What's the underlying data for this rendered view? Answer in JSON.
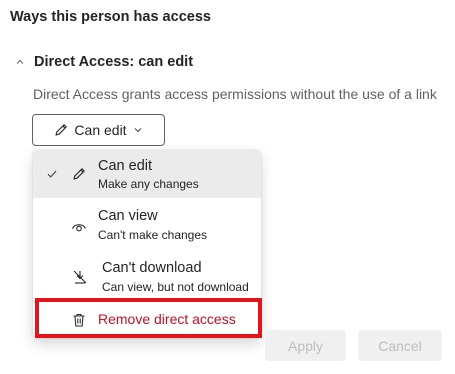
{
  "section_title": "Ways this person has access",
  "direct_access": {
    "title": "Direct Access: can edit",
    "description": "Direct Access grants access permissions without the use of a link",
    "dropdown_label": "Can edit",
    "dropdown_icon": "pencil-icon",
    "expanded": true
  },
  "menu": {
    "items": [
      {
        "label": "Can edit",
        "description": "Make any changes",
        "icon": "pencil-icon",
        "selected": true
      },
      {
        "label": "Can view",
        "description": "Can't make changes",
        "icon": "eye-icon",
        "selected": false
      },
      {
        "label": "Can't download",
        "description": "Can view, but not download",
        "icon": "no-download-icon",
        "selected": false
      }
    ],
    "remove": {
      "label": "Remove direct access",
      "icon": "trash-icon"
    }
  },
  "buttons": {
    "apply_label": "Apply",
    "cancel_label": "Cancel"
  },
  "colors": {
    "remove_text": "#c50f1f",
    "highlight_border": "#e0151e",
    "selected_bg": "#ebebeb",
    "disabled_button_bg": "#f0f0f0"
  }
}
